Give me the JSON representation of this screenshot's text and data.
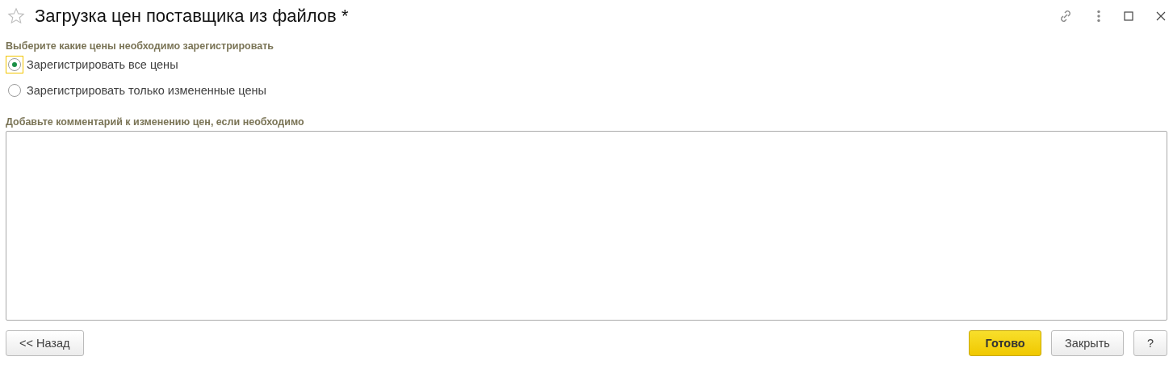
{
  "window": {
    "title": "Загрузка цен поставщика из файлов *",
    "favorite": false
  },
  "price_mode": {
    "label": "Выберите какие цены необходимо зарегистрировать",
    "options": [
      {
        "label": "Зарегистрировать все цены",
        "selected": true,
        "focused": true
      },
      {
        "label": "Зарегистрировать только измененные цены",
        "selected": false,
        "focused": false
      }
    ]
  },
  "comment": {
    "label": "Добавьте комментарий к изменению цен, если необходимо"
  },
  "buttons_left": [
    {
      "label": "<< Назад"
    }
  ],
  "buttons_right": [
    {
      "label": "Готово",
      "kind": "primary"
    },
    {
      "label": "Закрыть",
      "kind": "default"
    },
    {
      "label": "?",
      "kind": "default"
    }
  ]
}
